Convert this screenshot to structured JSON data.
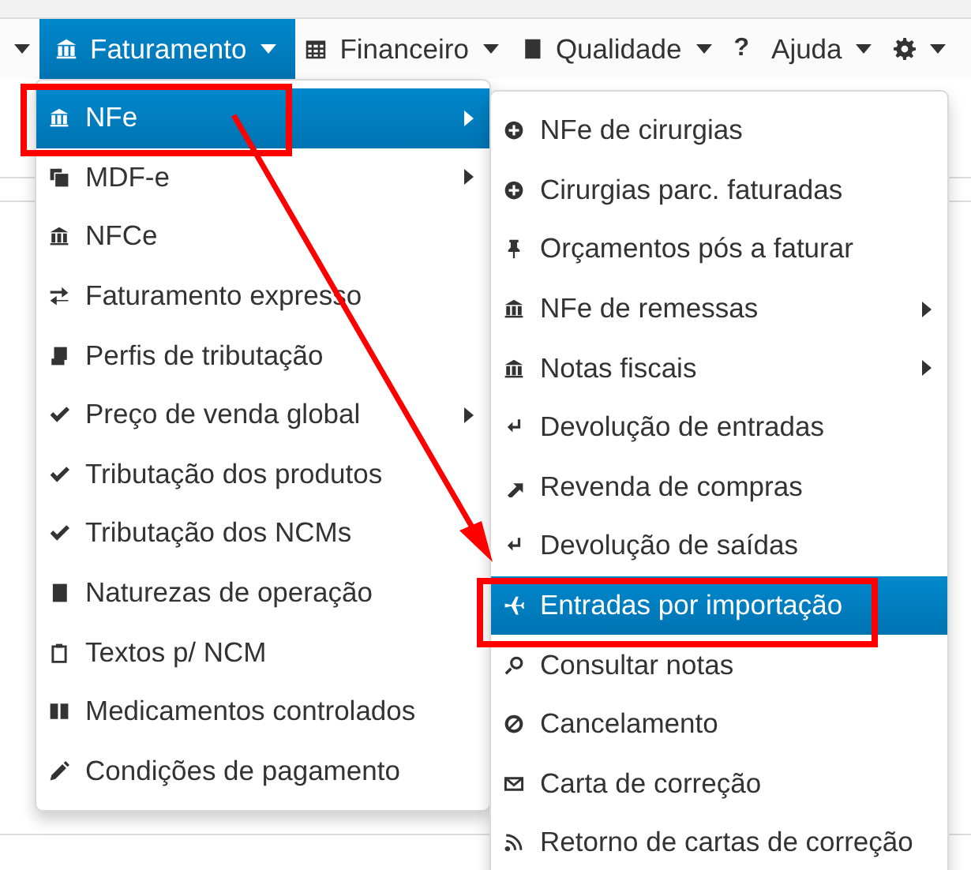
{
  "navbar": {
    "items": [
      {
        "kind": "caret",
        "selected": false
      },
      {
        "kind": "menu",
        "label": "Faturamento",
        "selected": true
      },
      {
        "kind": "menu",
        "label": "Financeiro",
        "selected": false
      },
      {
        "kind": "menu",
        "label": "Qualidade",
        "selected": false
      },
      {
        "kind": "glyph",
        "glyph": "?",
        "label": "Ajuda",
        "selected": false
      },
      {
        "kind": "menu",
        "selected": false
      }
    ]
  },
  "menu": {
    "items": [
      {
        "label": "NFe",
        "selected": true,
        "submenu": true
      },
      {
        "label": "MDF-e",
        "selected": false,
        "submenu": true
      },
      {
        "label": "NFCe",
        "selected": false,
        "submenu": false
      },
      {
        "label": "Faturamento expresso",
        "selected": false,
        "submenu": false
      },
      {
        "label": "Perfis de tributação",
        "selected": false,
        "submenu": false
      },
      {
        "label": "Preço de venda global",
        "selected": false,
        "submenu": true
      },
      {
        "label": "Tributação dos produtos",
        "selected": false,
        "submenu": false
      },
      {
        "label": "Tributação dos NCMs",
        "selected": false,
        "submenu": false
      },
      {
        "label": "Naturezas de operação",
        "selected": false,
        "submenu": false
      },
      {
        "label": "Textos p/ NCM",
        "selected": false,
        "submenu": false
      },
      {
        "label": "Medicamentos controlados",
        "selected": false,
        "submenu": false
      },
      {
        "label": "Condições de pagamento",
        "selected": false,
        "submenu": false
      }
    ]
  },
  "submenu": {
    "items": [
      {
        "label": "NFe de cirurgias",
        "selected": false,
        "submenu": false
      },
      {
        "label": "Cirurgias parc. faturadas",
        "selected": false,
        "submenu": false
      },
      {
        "label": "Orçamentos pós a faturar",
        "selected": false,
        "submenu": false
      },
      {
        "label": "NFe de remessas",
        "selected": false,
        "submenu": true
      },
      {
        "label": "Notas fiscais",
        "selected": false,
        "submenu": true
      },
      {
        "label": "Devolução de entradas",
        "selected": false,
        "submenu": false
      },
      {
        "label": "Revenda de compras",
        "selected": false,
        "submenu": false
      },
      {
        "label": "Devolução de saídas",
        "selected": false,
        "submenu": false
      },
      {
        "label": "Entradas por importação",
        "selected": true,
        "submenu": false
      },
      {
        "label": "Consultar notas",
        "selected": false,
        "submenu": false
      },
      {
        "label": "Cancelamento",
        "selected": false,
        "submenu": false
      },
      {
        "label": "Carta de correção",
        "selected": false,
        "submenu": false
      },
      {
        "label": "Retorno de cartas de correção",
        "selected": false,
        "submenu": false
      }
    ]
  }
}
